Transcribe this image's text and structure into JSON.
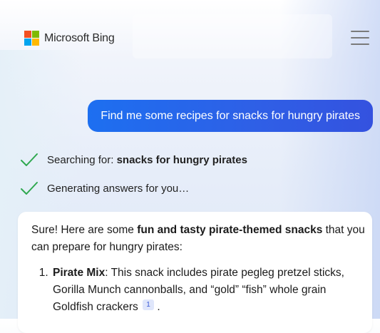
{
  "header": {
    "brand": "Microsoft Bing",
    "logo_colors": [
      "#f25022",
      "#7fba00",
      "#00a4ef",
      "#ffb900"
    ],
    "menu_icon": "hamburger-menu-icon"
  },
  "user_message": "Find me some recipes for snacks for hungry pirates",
  "status": [
    {
      "prefix": "Searching for: ",
      "bold": "snacks for hungry pirates",
      "icon": "check-icon"
    },
    {
      "prefix": "Generating answers for you…",
      "bold": "",
      "icon": "check-icon"
    }
  ],
  "answer": {
    "intro_before": "Sure! Here are some ",
    "intro_bold": "fun and tasty pirate-themed snacks",
    "intro_after": " that you can prepare for hungry pirates:",
    "items": [
      {
        "title": "Pirate Mix",
        "text": ": This snack includes pirate pegleg pretzel sticks, Gorilla Munch cannonballs, and “gold” “fish” whole grain Goldfish crackers",
        "citation": "1",
        "end": " ."
      }
    ]
  },
  "colors": {
    "accent": "#1d6ff0",
    "check": "#2fa84f"
  }
}
